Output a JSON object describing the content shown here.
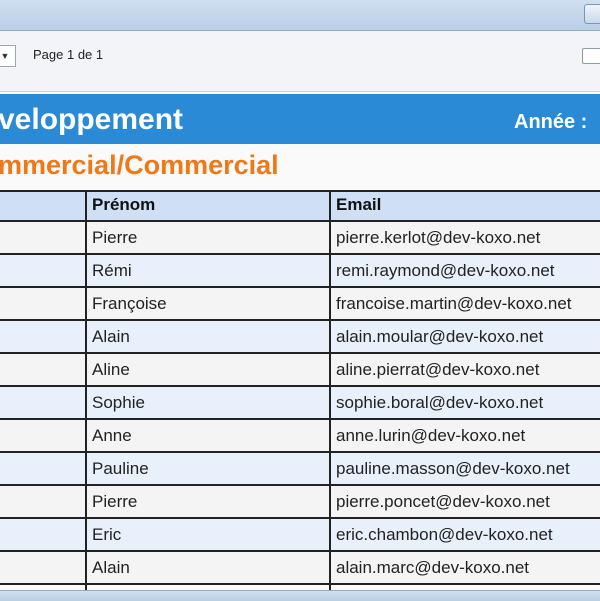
{
  "toolbar": {
    "page_info": "Page 1 de 1"
  },
  "report": {
    "title": "veloppement",
    "year_label": "Année :",
    "department": "mmercial/Commercial",
    "columns": [
      "Prénom",
      "Email"
    ],
    "rows": [
      {
        "prenom": "Pierre",
        "email": "pierre.kerlot@dev-koxo.net"
      },
      {
        "prenom": "Rémi",
        "email": "remi.raymond@dev-koxo.net"
      },
      {
        "prenom": "Françoise",
        "email": "francoise.martin@dev-koxo.net"
      },
      {
        "prenom": "Alain",
        "email": "alain.moular@dev-koxo.net"
      },
      {
        "prenom": "Aline",
        "email": "aline.pierrat@dev-koxo.net"
      },
      {
        "prenom": "Sophie",
        "email": "sophie.boral@dev-koxo.net"
      },
      {
        "prenom": "Anne",
        "email": "anne.lurin@dev-koxo.net"
      },
      {
        "prenom": "Pauline",
        "email": "pauline.masson@dev-koxo.net"
      },
      {
        "prenom": "Pierre",
        "email": "pierre.poncet@dev-koxo.net"
      },
      {
        "prenom": "Eric",
        "email": "eric.chambon@dev-koxo.net"
      },
      {
        "prenom": "Alain",
        "email": "alain.marc@dev-koxo.net"
      }
    ]
  }
}
